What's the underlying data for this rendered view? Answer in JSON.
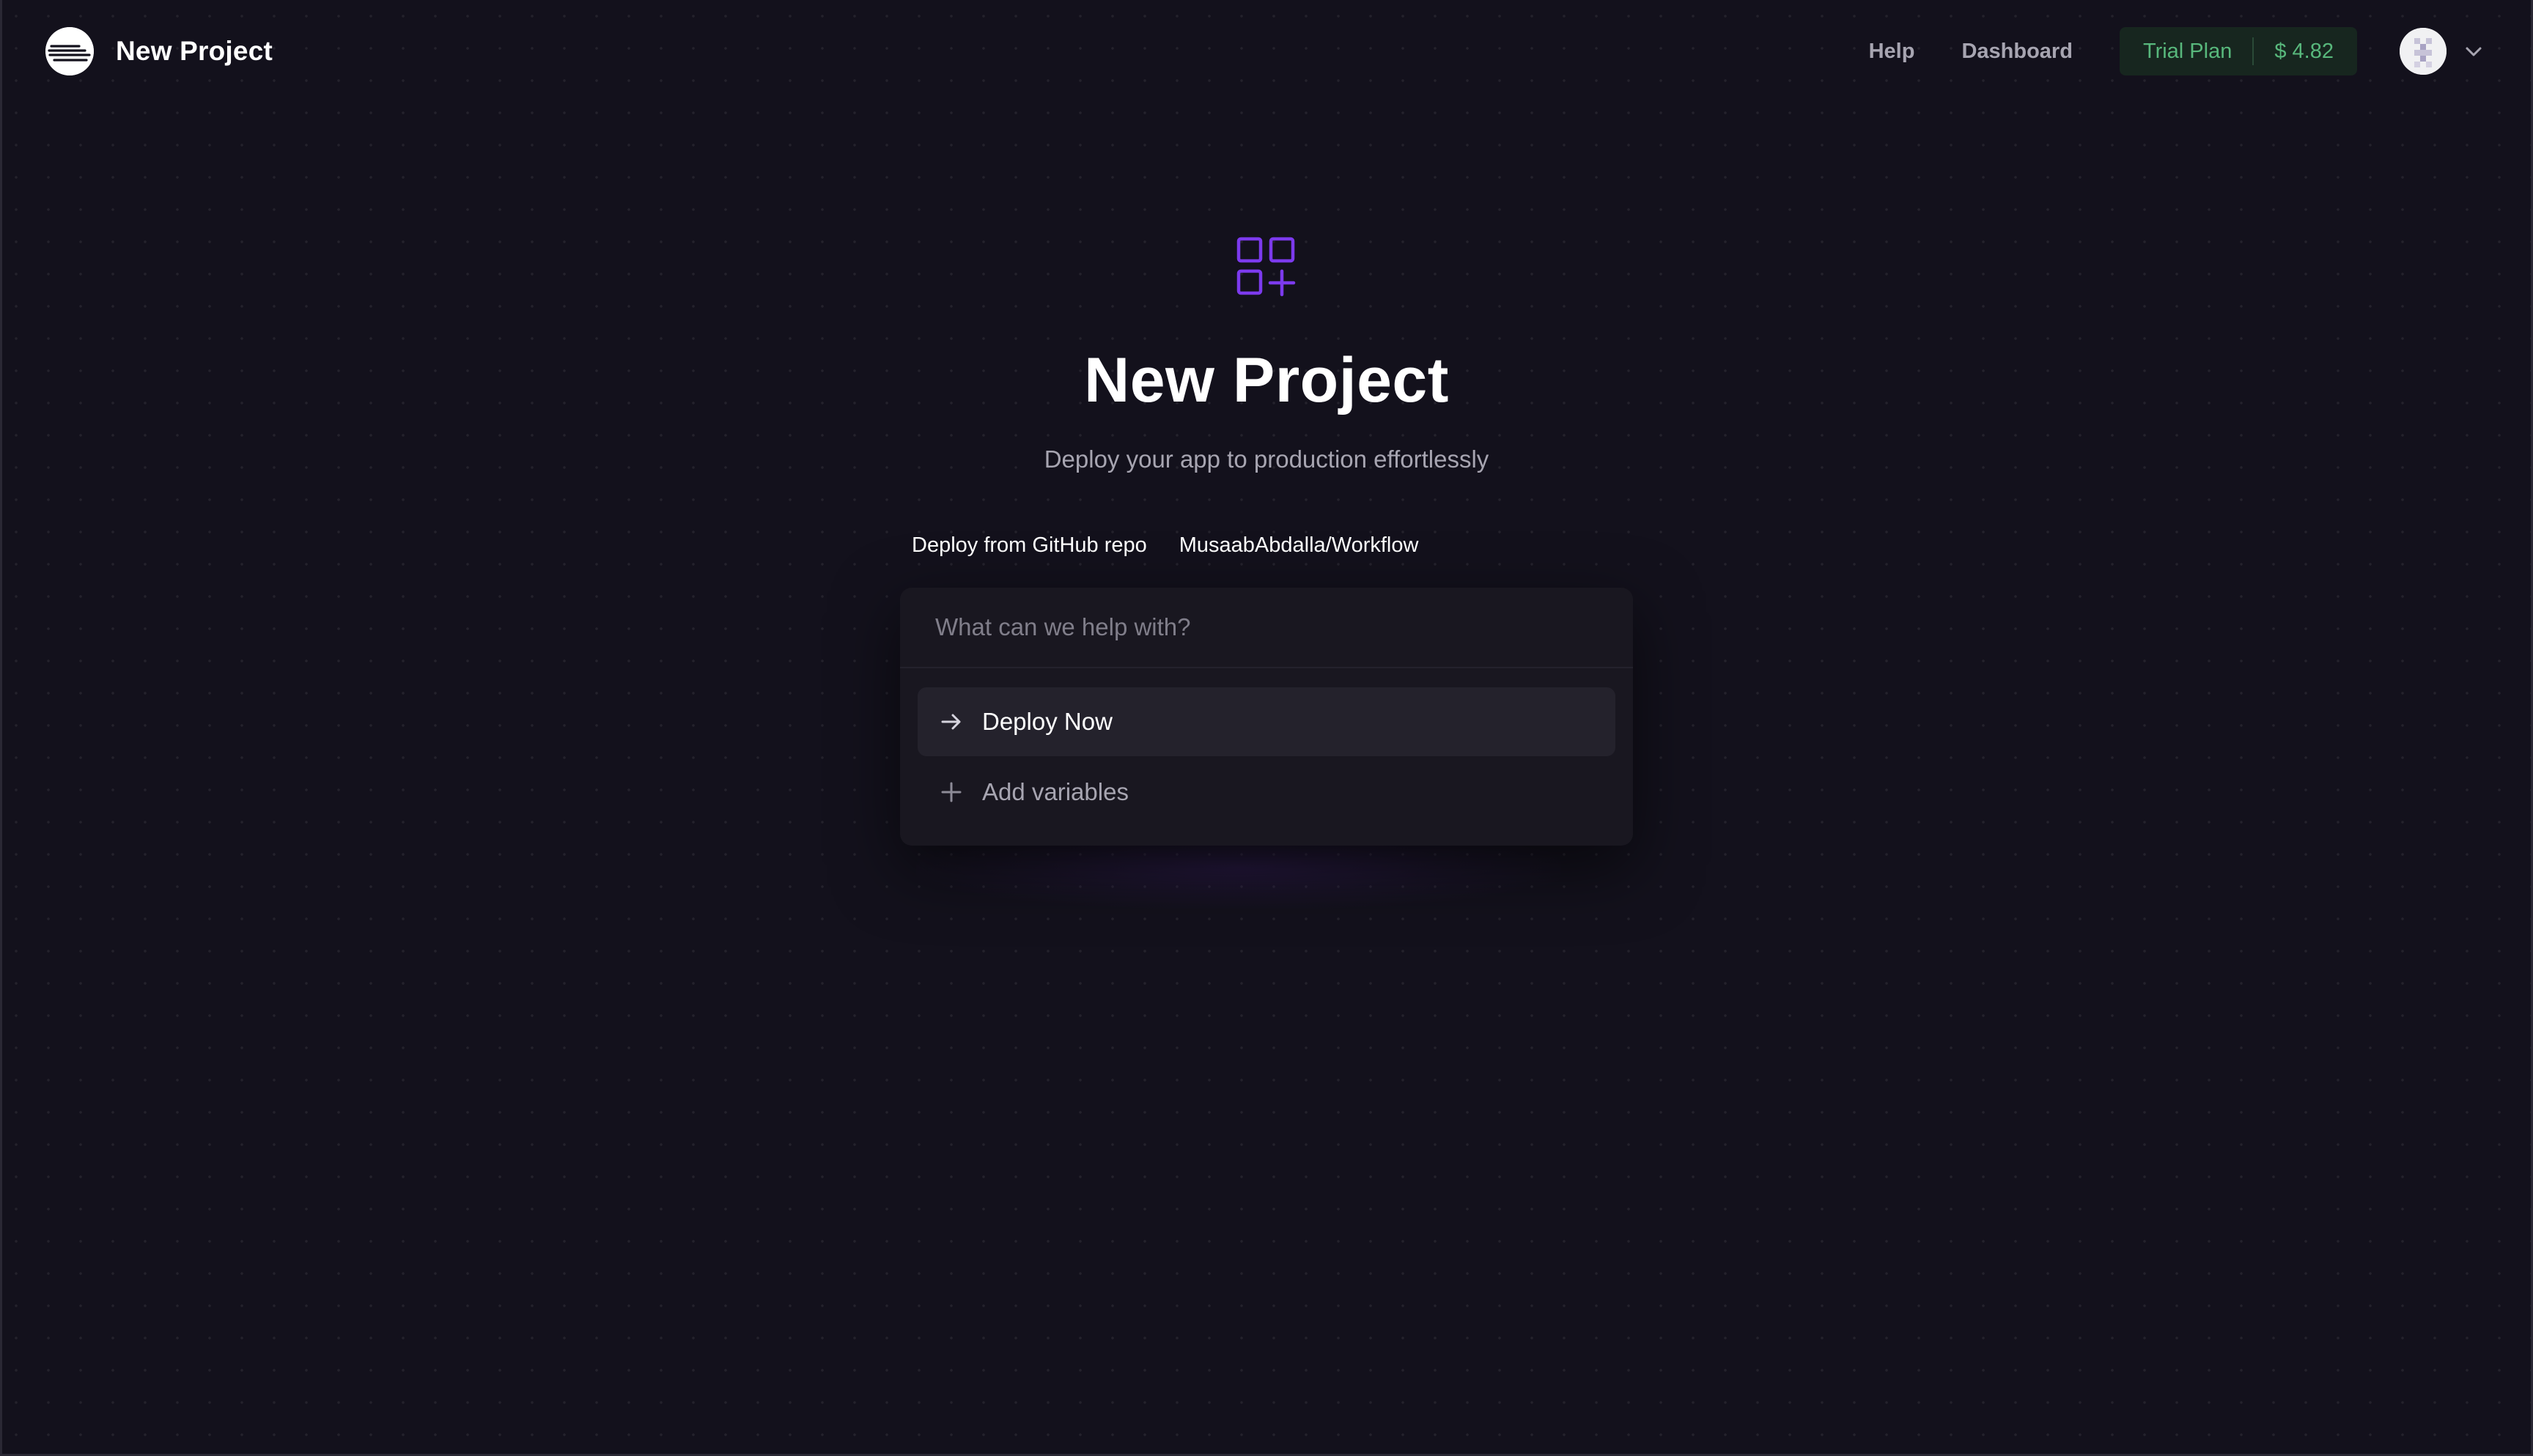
{
  "header": {
    "brand_title": "New Project",
    "nav": {
      "help_label": "Help",
      "dashboard_label": "Dashboard"
    },
    "plan": {
      "label": "Trial Plan",
      "credit": "$ 4.82"
    }
  },
  "hero": {
    "icon": "apps-add-icon",
    "title": "New Project",
    "subtitle": "Deploy your app to production effortlessly"
  },
  "breadcrumb": {
    "items": [
      "Deploy from GitHub repo",
      "MusaabAbdalla/Workflow"
    ]
  },
  "command_panel": {
    "placeholder": "What can we help with?",
    "options": [
      {
        "icon": "arrow-right-icon",
        "label": "Deploy Now",
        "selected": true
      },
      {
        "icon": "plus-icon",
        "label": "Add variables",
        "selected": false
      }
    ]
  },
  "colors": {
    "background": "#13111c",
    "accent_purple": "#7c3aed",
    "plan_green": "#58b87c",
    "panel": "#191720"
  }
}
